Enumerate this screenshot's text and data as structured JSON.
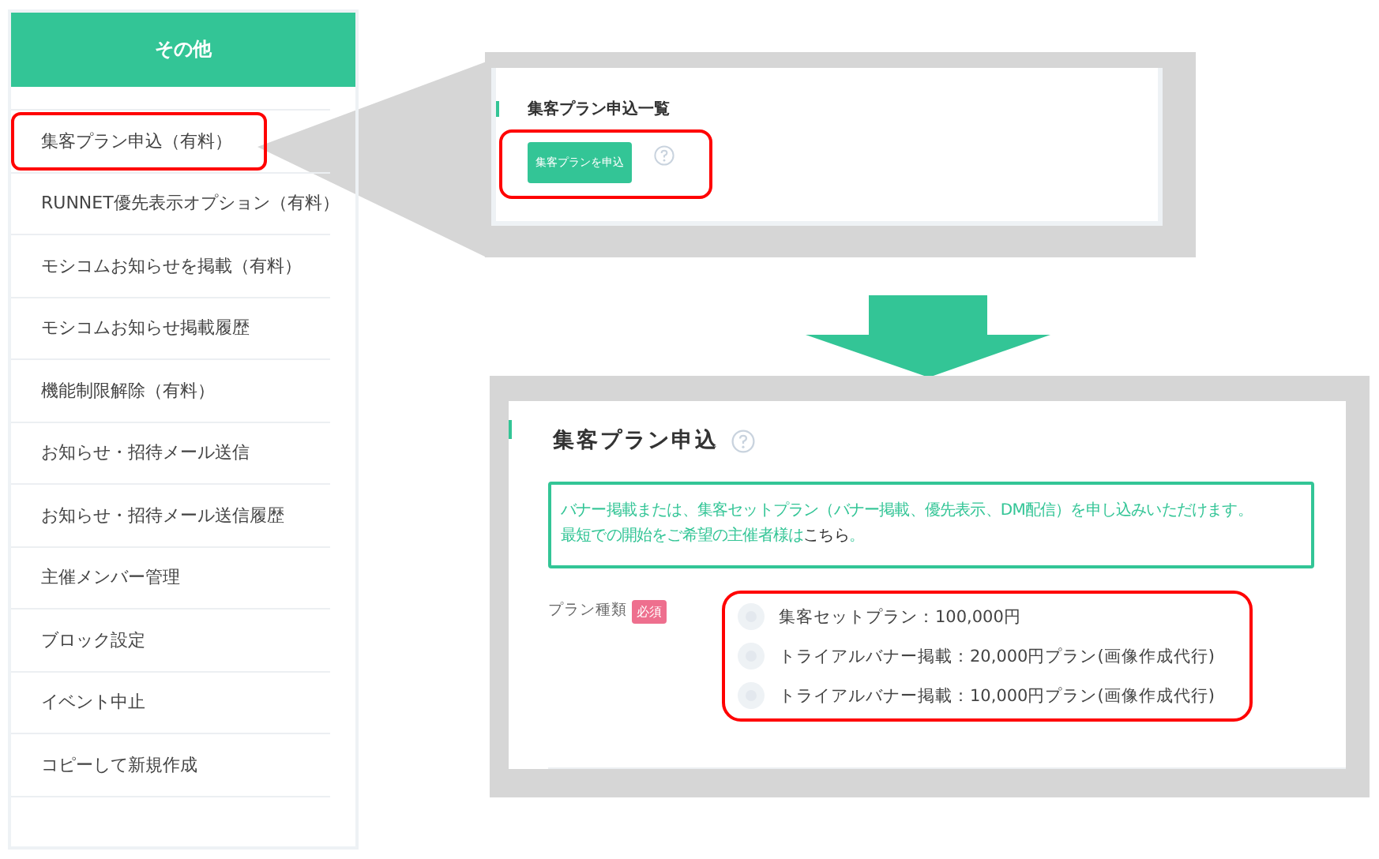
{
  "sidebar": {
    "title": "その他",
    "items": [
      {
        "label": "集客プラン申込（有料）",
        "highlighted": true
      },
      {
        "label": "RUNNET優先表示オプション（有料）",
        "highlighted": false
      },
      {
        "label": "モシコムお知らせを掲載（有料）",
        "highlighted": false
      },
      {
        "label": "モシコムお知らせ掲載履歴",
        "highlighted": false
      },
      {
        "label": "機能制限解除（有料）",
        "highlighted": false
      },
      {
        "label": "お知らせ・招待メール送信",
        "highlighted": false
      },
      {
        "label": "お知らせ・招待メール送信履歴",
        "highlighted": false
      },
      {
        "label": "主催メンバー管理",
        "highlighted": false
      },
      {
        "label": "ブロック設定",
        "highlighted": false
      },
      {
        "label": "イベント中止",
        "highlighted": false
      },
      {
        "label": "コピーして新規作成",
        "highlighted": false
      }
    ]
  },
  "list_panel": {
    "title": "集客プラン申込一覧",
    "button": "集客プランを申込",
    "button_highlighted": true
  },
  "form_panel": {
    "title": "集客プラン申込",
    "notice": {
      "line_1": "バナー掲載または、集客セットプラン（バナー掲載、優先表示、DM配信）を申し込みいただけます。",
      "line_2": "最短での開始をご希望の主催者様は",
      "link": "こちら",
      "line_2_end": "。"
    },
    "field_label": "プラン種類",
    "required_badge": "必須",
    "options_highlighted": true,
    "options": [
      {
        "label": "集客セットプラン：100,000円",
        "selected": false
      },
      {
        "label": "トライアルバナー掲載：20,000円プラン(画像作成代行)",
        "selected": false
      },
      {
        "label": "トライアルバナー掲載：10,000円プラン(画像作成代行)",
        "selected": false
      }
    ]
  }
}
